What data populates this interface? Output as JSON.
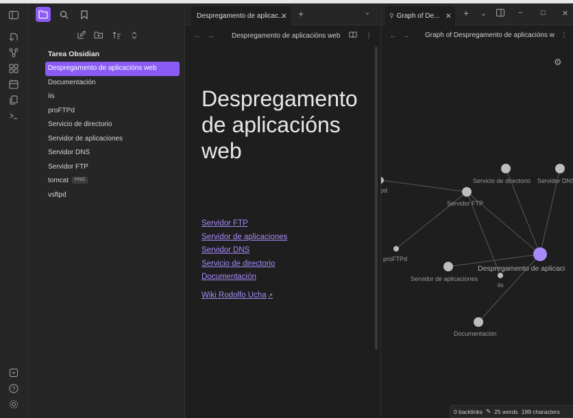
{
  "ribbon": {
    "icons": [
      "sidebar-toggle-icon",
      "open-quick-switcher-icon",
      "graph-view-icon",
      "canvas-icon",
      "daily-note-icon",
      "templates-icon",
      "terminal-icon",
      "vault-switch-icon",
      "help-icon",
      "settings-icon"
    ]
  },
  "sidebar": {
    "tabs": [
      "files-icon",
      "search-icon",
      "bookmarks-icon"
    ],
    "vault_name": "Tarea Obsidian",
    "items": [
      {
        "label": "Despregamento de aplicacións web",
        "selected": true
      },
      {
        "label": "Documentación"
      },
      {
        "label": "iis"
      },
      {
        "label": "proFTPd"
      },
      {
        "label": "Servicio de directorio"
      },
      {
        "label": "Servidor de aplicaciones"
      },
      {
        "label": "Servidor DNS"
      },
      {
        "label": "Servidor FTP"
      },
      {
        "label": "tomcat",
        "badge": "PNG"
      },
      {
        "label": "vsftpd"
      }
    ]
  },
  "editor": {
    "tab_label": "Despregamento de aplicac...",
    "view_title": "Despregamento de aplicacións web",
    "doc_title": "Despregamento de aplicacións web",
    "links": [
      "Servidor FTP",
      "Servidor de aplicaciones",
      "Servidor DNS",
      "Servicio de directorio",
      "Documentación"
    ],
    "external_link": "Wiki Rodolfo Ucha"
  },
  "graph": {
    "tab_label": "Graph of De...",
    "view_title": "Graph of Despregamento de aplicacións w",
    "nodes": [
      {
        "label": "Servicio de directorio",
        "color": "#bdbdbd"
      },
      {
        "label": "Servidor DNS",
        "color": "#bdbdbd"
      },
      {
        "label": "Servidor FTP",
        "color": "#bdbdbd"
      },
      {
        "label": "vsftpd",
        "display": "pd",
        "color": "#bdbdbd"
      },
      {
        "label": "proFTPd",
        "color": "#bdbdbd"
      },
      {
        "label": "Despregamento de aplicacións web",
        "display": "Despregamento de aplicaci",
        "color": "#a88bfa"
      },
      {
        "label": "Servidor de aplicaciones",
        "color": "#bdbdbd"
      },
      {
        "label": "iis",
        "color": "#bdbdbd"
      },
      {
        "label": "Documentación",
        "color": "#bdbdbd"
      }
    ]
  },
  "status": {
    "backlinks": "0 backlinks",
    "words": "25 words",
    "characters": "199 characters"
  },
  "colors": {
    "accent": "#8a5cf5",
    "link": "#a78bfa",
    "node": "#bdbdbd",
    "active_node": "#a88bfa"
  }
}
